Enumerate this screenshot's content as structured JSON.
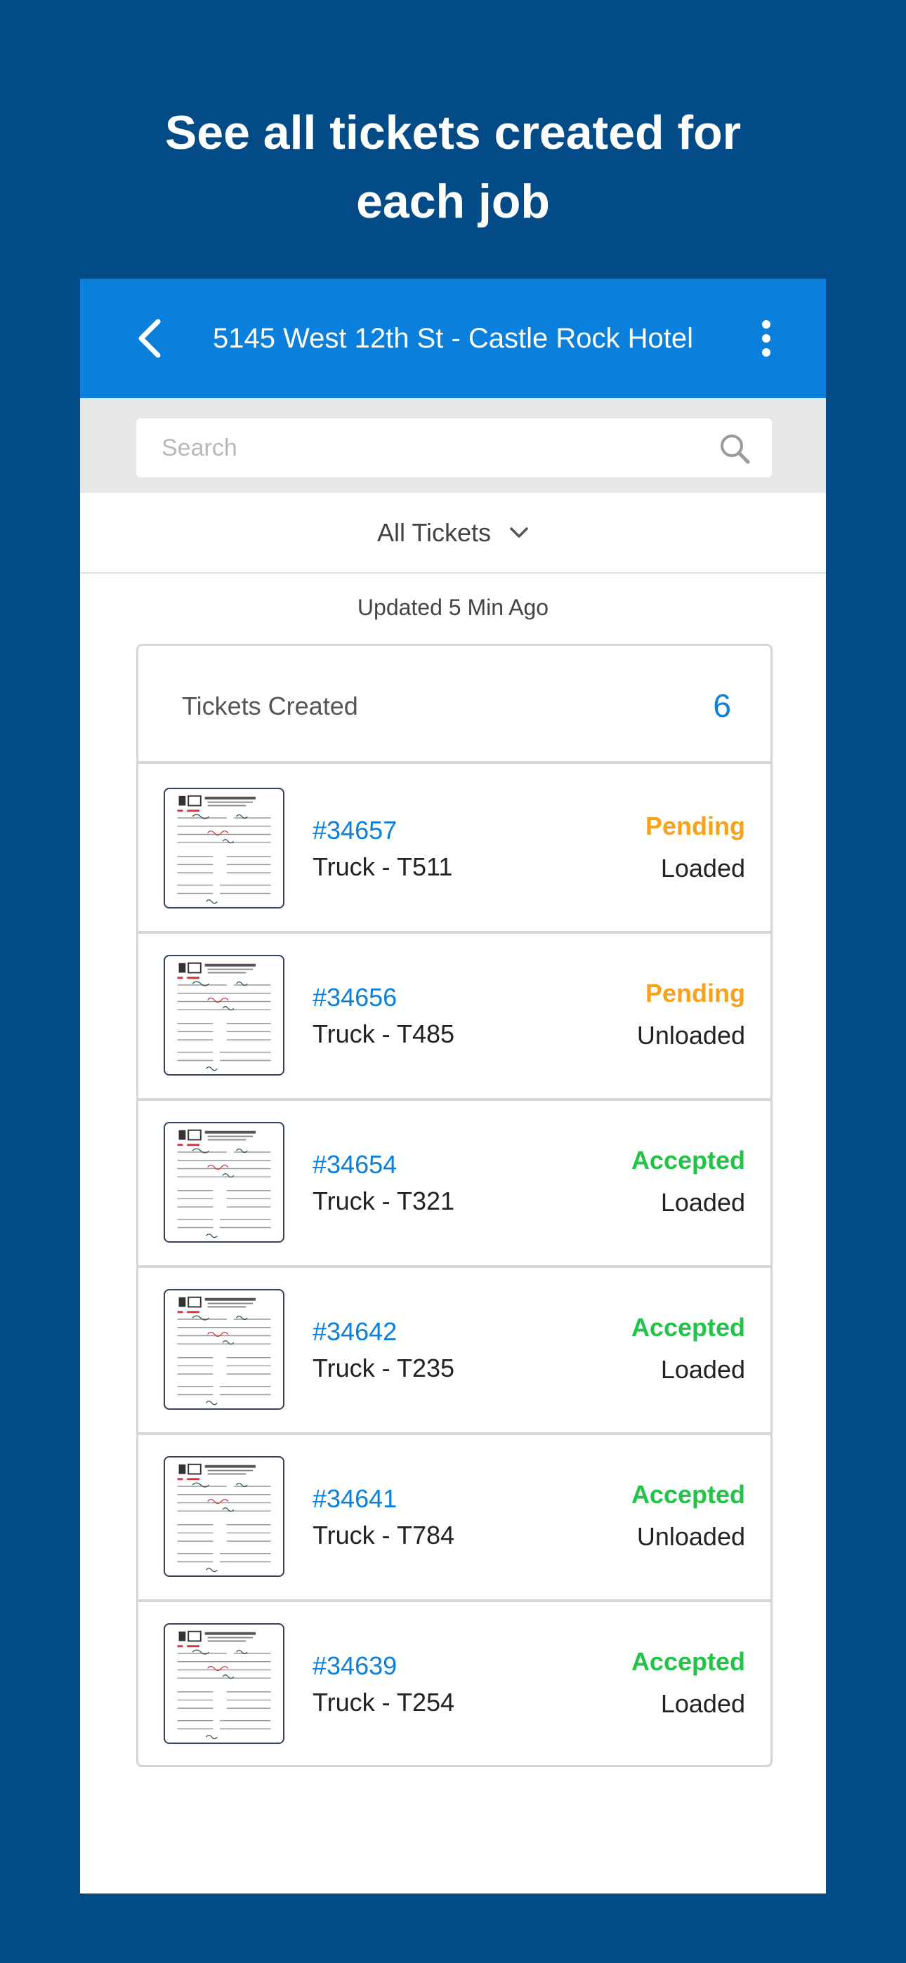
{
  "promo": {
    "headline_line1": "See all tickets created for",
    "headline_line2": "each job"
  },
  "appbar": {
    "title": "5145 West 12th St - Castle Rock Hotel",
    "back_icon": "chevron-left-icon",
    "menu_icon": "more-vertical-icon"
  },
  "search": {
    "placeholder": "Search",
    "value": "",
    "icon": "search-icon"
  },
  "filter": {
    "selected": "All Tickets",
    "icon": "chevron-down-icon"
  },
  "updated_text": "Updated 5 Min Ago",
  "summary": {
    "label": "Tickets Created",
    "count": "6"
  },
  "colors": {
    "background": "#024b86",
    "appbar": "#0a7fdb",
    "link": "#0a7fdb",
    "pending": "#f7a21b",
    "accepted": "#22c447"
  },
  "tickets": [
    {
      "id": "#34657",
      "truck": "Truck - T511",
      "status": "Pending",
      "status_color": "#f7a21b",
      "load": "Loaded"
    },
    {
      "id": "#34656",
      "truck": "Truck - T485",
      "status": "Pending",
      "status_color": "#f7a21b",
      "load": "Unloaded"
    },
    {
      "id": "#34654",
      "truck": "Truck - T321",
      "status": "Accepted",
      "status_color": "#22c447",
      "load": "Loaded"
    },
    {
      "id": "#34642",
      "truck": "Truck - T235",
      "status": "Accepted",
      "status_color": "#22c447",
      "load": "Loaded"
    },
    {
      "id": "#34641",
      "truck": "Truck - T784",
      "status": "Accepted",
      "status_color": "#22c447",
      "load": "Unloaded"
    },
    {
      "id": "#34639",
      "truck": "Truck - T254",
      "status": "Accepted",
      "status_color": "#22c447",
      "load": "Loaded"
    }
  ]
}
